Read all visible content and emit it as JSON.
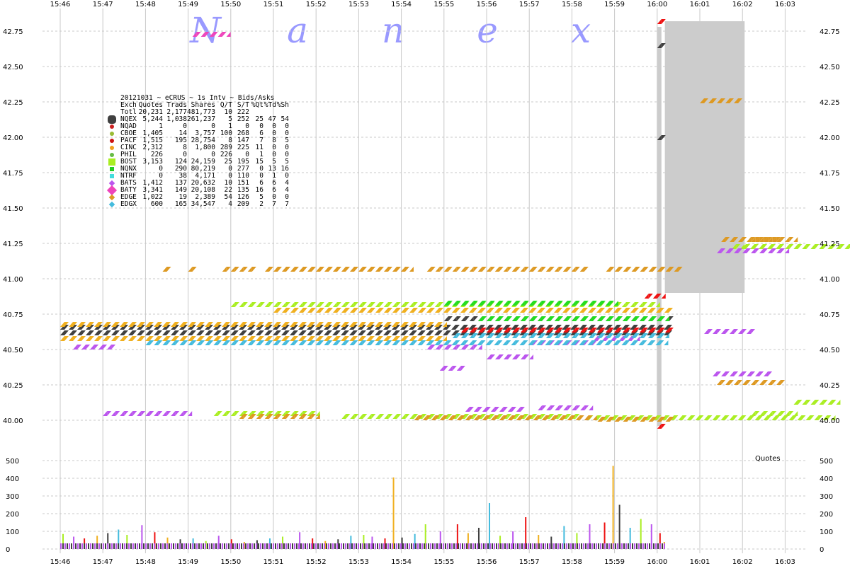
{
  "watermark": [
    "N",
    "a",
    "n",
    "e",
    "x"
  ],
  "legend": {
    "title": "20121031 ~ eCRUS ~ 1s Intv ~ Bids/Asks",
    "headers": [
      "Exch",
      "Quotes",
      "Trads",
      "Shares",
      "Q/T",
      "S/T",
      "%Qt",
      "%Td",
      "%Sh"
    ],
    "total": [
      "Totl",
      "20,231",
      "2,177",
      "481,773",
      "10",
      "222",
      "",
      "",
      ""
    ],
    "rows": [
      {
        "exch": "NQEX",
        "cells": [
          "5,244",
          "1,038",
          "261,237",
          "5",
          "252",
          "25",
          "47",
          "54"
        ],
        "color": "#404040",
        "shape": "octagon",
        "big": true
      },
      {
        "exch": "NQAD",
        "cells": [
          "1",
          "0",
          "0",
          "1",
          "0",
          "0",
          "0",
          "0"
        ],
        "color": "#cc2020",
        "shape": "dot"
      },
      {
        "exch": "CBOE",
        "cells": [
          "1,405",
          "14",
          "3,757",
          "100",
          "268",
          "6",
          "0",
          "0"
        ],
        "color": "#99bb33",
        "shape": "dot"
      },
      {
        "exch": "PACF",
        "cells": [
          "1,515",
          "195",
          "28,754",
          "8",
          "147",
          "7",
          "8",
          "5"
        ],
        "color": "#cc1111",
        "shape": "dot"
      },
      {
        "exch": "CINC",
        "cells": [
          "2,312",
          "8",
          "1,800",
          "289",
          "225",
          "11",
          "0",
          "0"
        ],
        "color": "#f0a020",
        "shape": "dot"
      },
      {
        "exch": "PHIL",
        "cells": [
          "226",
          "0",
          "0",
          "226",
          "0",
          "1",
          "0",
          "0"
        ],
        "color": "#66bb44",
        "shape": "dot"
      },
      {
        "exch": "BOST",
        "cells": [
          "3,153",
          "124",
          "24,159",
          "25",
          "195",
          "15",
          "5",
          "5"
        ],
        "color": "#aaee22",
        "shape": "square",
        "big": true
      },
      {
        "exch": "NQNX",
        "cells": [
          "0",
          "290",
          "80,219",
          "0",
          "277",
          "0",
          "13",
          "16"
        ],
        "color": "#22cc22",
        "shape": "square"
      },
      {
        "exch": "NTRF",
        "cells": [
          "0",
          "38",
          "4,171",
          "0",
          "110",
          "0",
          "1",
          "0"
        ],
        "color": "#44dddd",
        "shape": "square"
      },
      {
        "exch": "BATS",
        "cells": [
          "1,412",
          "137",
          "20,632",
          "10",
          "151",
          "6",
          "6",
          "4"
        ],
        "color": "#bb55ee",
        "shape": "diamond"
      },
      {
        "exch": "BATY",
        "cells": [
          "3,341",
          "149",
          "20,108",
          "22",
          "135",
          "16",
          "6",
          "4"
        ],
        "color": "#ee44bb",
        "shape": "diamond",
        "big": true
      },
      {
        "exch": "EDGE",
        "cells": [
          "1,022",
          "19",
          "2,389",
          "54",
          "126",
          "5",
          "0",
          "0"
        ],
        "color": "#dd9922",
        "shape": "diamond"
      },
      {
        "exch": "EDGX",
        "cells": [
          "600",
          "165",
          "34,547",
          "4",
          "209",
          "2",
          "7",
          "7"
        ],
        "color": "#44bbdd",
        "shape": "diamond"
      }
    ]
  },
  "chart_data": [
    {
      "type": "scatter",
      "title": "",
      "xlabel": "",
      "ylabel": "",
      "x_ticks": [
        "15:46",
        "15:47",
        "15:48",
        "15:49",
        "15:50",
        "15:51",
        "15:52",
        "15:53",
        "15:54",
        "15:55",
        "15:56",
        "15:57",
        "15:58",
        "15:59",
        "16:00",
        "16:01",
        "16:02",
        "16:03"
      ],
      "y_ticks": [
        "42.75",
        "42.50",
        "42.25",
        "42.00",
        "41.75",
        "41.50",
        "41.25",
        "41.00",
        "40.75",
        "40.50",
        "40.25",
        "40.00"
      ],
      "ylim": [
        39.9,
        42.82
      ],
      "grid": true,
      "series": [
        {
          "name": "BOST",
          "color": "#aaee22",
          "segments": [
            [
              15.75,
              15.95,
              41.23
            ],
            [
              15.98,
              16.95,
              41.23
            ],
            [
              17.0,
              18.6,
              41.23
            ],
            [
              19.0,
              24.5,
              41.23
            ],
            [
              24.5,
              26.5,
              41.23
            ],
            [
              3.6,
              6.0,
              40.05
            ],
            [
              6.6,
              12.1,
              40.03
            ],
            [
              12.3,
              18.1,
              40.02
            ],
            [
              16.2,
              17.2,
              40.05
            ],
            [
              17.2,
              18.2,
              40.13
            ],
            [
              4.0,
              14.0,
              40.82
            ]
          ]
        },
        {
          "name": "EDGE",
          "color": "#dd9922",
          "segments": [
            [
              2.4,
              2.5,
              41.07
            ],
            [
              3.0,
              3.1,
              41.07
            ],
            [
              3.8,
              4.5,
              41.07
            ],
            [
              4.8,
              8.2,
              41.07
            ],
            [
              8.6,
              12.3,
              41.07
            ],
            [
              12.8,
              14.5,
              41.07
            ],
            [
              15.0,
              15.9,
              42.26
            ],
            [
              4.2,
              6.0,
              40.03
            ],
            [
              8.3,
              12.5,
              40.02
            ],
            [
              12.6,
              14.3,
              40.01
            ],
            [
              15.4,
              16.9,
              40.27
            ],
            [
              15.5,
              16.8,
              41.28
            ],
            [
              16.2,
              17.2,
              41.28
            ]
          ]
        },
        {
          "name": "BATS",
          "color": "#bb55ee",
          "segments": [
            [
              0.3,
              1.2,
              40.52
            ],
            [
              8.6,
              9.8,
              40.52
            ],
            [
              8.9,
              9.4,
              40.37
            ],
            [
              10.0,
              11.0,
              40.45
            ],
            [
              11.0,
              12.5,
              40.55
            ],
            [
              12.5,
              13.5,
              40.58
            ],
            [
              15.4,
              17.0,
              41.2
            ],
            [
              15.3,
              16.6,
              40.33
            ],
            [
              15.1,
              16.2,
              40.63
            ],
            [
              1.0,
              3.0,
              40.05
            ],
            [
              9.5,
              10.8,
              40.08
            ],
            [
              11.2,
              12.4,
              40.09
            ]
          ]
        },
        {
          "name": "NQEX",
          "color": "#404040",
          "segments": [
            [
              0.0,
              14.3,
              40.62
            ],
            [
              0.0,
              14.3,
              40.66
            ],
            [
              9.0,
              14.3,
              40.72
            ],
            [
              14.0,
              14.1,
              42.65
            ],
            [
              14.0,
              14.1,
              42.0
            ]
          ]
        },
        {
          "name": "PACF",
          "color": "#ee1111",
          "segments": [
            [
              9.4,
              14.3,
              40.64
            ],
            [
              13.7,
              14.1,
              40.88
            ],
            [
              14.0,
              14.1,
              42.82
            ],
            [
              14.0,
              14.1,
              39.96
            ]
          ]
        },
        {
          "name": "CINC",
          "color": "#f0b020",
          "segments": [
            [
              0.0,
              9.0,
              40.58
            ],
            [
              0.0,
              9.0,
              40.68
            ],
            [
              5.0,
              14.3,
              40.78
            ]
          ]
        },
        {
          "name": "NQNX",
          "color": "#22dd22",
          "segments": [
            [
              9.8,
              14.2,
              40.72
            ],
            [
              9.0,
              13.0,
              40.83
            ]
          ]
        },
        {
          "name": "EDGX",
          "color": "#44bbdd",
          "segments": [
            [
              2.0,
              14.2,
              40.55
            ],
            [
              9.2,
              14.2,
              40.6
            ]
          ]
        },
        {
          "name": "BATY",
          "color": "#ee44bb",
          "segments": [
            [
              3.1,
              3.9,
              42.73
            ]
          ]
        }
      ],
      "grey_band": {
        "x": [
          14.0,
          14.05
        ],
        "y": [
          39.96,
          42.78
        ]
      },
      "grey_box": {
        "x": [
          14.18,
          16.05
        ],
        "y": [
          40.9,
          42.82
        ]
      }
    },
    {
      "type": "bar",
      "title": "",
      "xlabel": "",
      "ylabel": "",
      "legend": "Quotes",
      "y_ticks": [
        "500",
        "400",
        "300",
        "200",
        "100",
        "0"
      ],
      "ylim": [
        0,
        500
      ],
      "spikes": [
        {
          "x": 0.05,
          "v": 85
        },
        {
          "x": 0.3,
          "v": 70
        },
        {
          "x": 0.55,
          "v": 60
        },
        {
          "x": 0.85,
          "v": 75
        },
        {
          "x": 1.1,
          "v": 90
        },
        {
          "x": 1.35,
          "v": 110
        },
        {
          "x": 1.55,
          "v": 80
        },
        {
          "x": 1.9,
          "v": 135
        },
        {
          "x": 2.2,
          "v": 95
        },
        {
          "x": 2.5,
          "v": 65
        },
        {
          "x": 2.8,
          "v": 55
        },
        {
          "x": 3.1,
          "v": 60
        },
        {
          "x": 3.4,
          "v": 45
        },
        {
          "x": 3.7,
          "v": 75
        },
        {
          "x": 4.0,
          "v": 55
        },
        {
          "x": 4.3,
          "v": 40
        },
        {
          "x": 4.6,
          "v": 50
        },
        {
          "x": 4.9,
          "v": 60
        },
        {
          "x": 5.2,
          "v": 70
        },
        {
          "x": 5.6,
          "v": 95
        },
        {
          "x": 5.9,
          "v": 60
        },
        {
          "x": 6.2,
          "v": 45
        },
        {
          "x": 6.5,
          "v": 55
        },
        {
          "x": 6.8,
          "v": 75
        },
        {
          "x": 7.1,
          "v": 80
        },
        {
          "x": 7.3,
          "v": 70
        },
        {
          "x": 7.6,
          "v": 60
        },
        {
          "x": 7.8,
          "v": 405
        },
        {
          "x": 8.0,
          "v": 65
        },
        {
          "x": 8.3,
          "v": 85
        },
        {
          "x": 8.55,
          "v": 140
        },
        {
          "x": 8.9,
          "v": 100
        },
        {
          "x": 9.3,
          "v": 140
        },
        {
          "x": 9.55,
          "v": 90
        },
        {
          "x": 9.8,
          "v": 120
        },
        {
          "x": 10.05,
          "v": 260
        },
        {
          "x": 10.3,
          "v": 75
        },
        {
          "x": 10.6,
          "v": 100
        },
        {
          "x": 10.9,
          "v": 180
        },
        {
          "x": 11.2,
          "v": 80
        },
        {
          "x": 11.5,
          "v": 70
        },
        {
          "x": 11.8,
          "v": 130
        },
        {
          "x": 12.1,
          "v": 90
        },
        {
          "x": 12.4,
          "v": 140
        },
        {
          "x": 12.75,
          "v": 150
        },
        {
          "x": 12.95,
          "v": 470
        },
        {
          "x": 13.1,
          "v": 250
        },
        {
          "x": 13.35,
          "v": 120
        },
        {
          "x": 13.6,
          "v": 170
        },
        {
          "x": 13.85,
          "v": 140
        },
        {
          "x": 14.05,
          "v": 90
        },
        {
          "x": 14.15,
          "v": 40
        }
      ]
    }
  ]
}
